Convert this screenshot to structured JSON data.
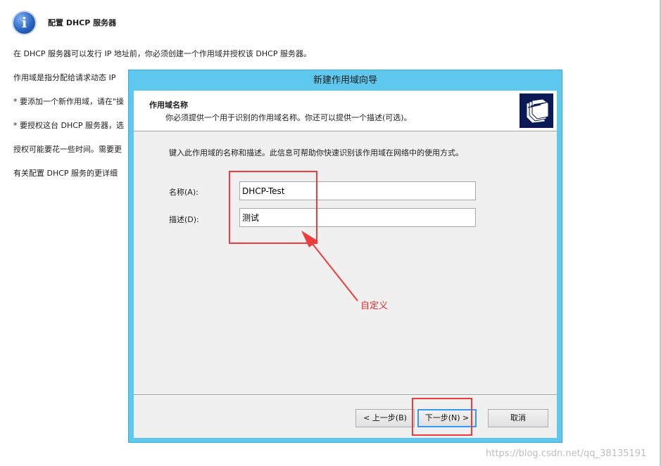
{
  "background": {
    "title": "配置 DHCP 服务器",
    "lines": [
      "在 DHCP 服务器可以发行 IP 地址前，你必须创建一个作用域并授权该 DHCP 服务器。",
      "作用域是指分配给请求动态 IP",
      "* 要添加一个新作用域，请在\"操",
      "* 要授权这台 DHCP 服务器，选",
      "授权可能要花一些时间。需要更",
      "有关配置 DHCP 服务的更详细"
    ],
    "icon": "info-icon"
  },
  "dialog": {
    "title": "新建作用域向导",
    "header_title": "作用域名称",
    "header_subtitle": "你必须提供一个用于识别的作用域名称。你还可以提供一个描述(可选)。",
    "header_icon": "folders-icon",
    "intro": "键入此作用域的名称和描述。此信息可帮助你快速识别该作用域在网络中的使用方式。",
    "name_label": "名称(A):",
    "name_value": "DHCP-Test",
    "desc_label": "描述(D):",
    "desc_value": "测试",
    "back_button": "< 上一步(B)",
    "next_button": "下一步(N) >",
    "cancel_button": "取消"
  },
  "annotation": {
    "text": "自定义",
    "color": "#e03030"
  },
  "watermark": "https://blog.csdn.net/qq_38135191"
}
